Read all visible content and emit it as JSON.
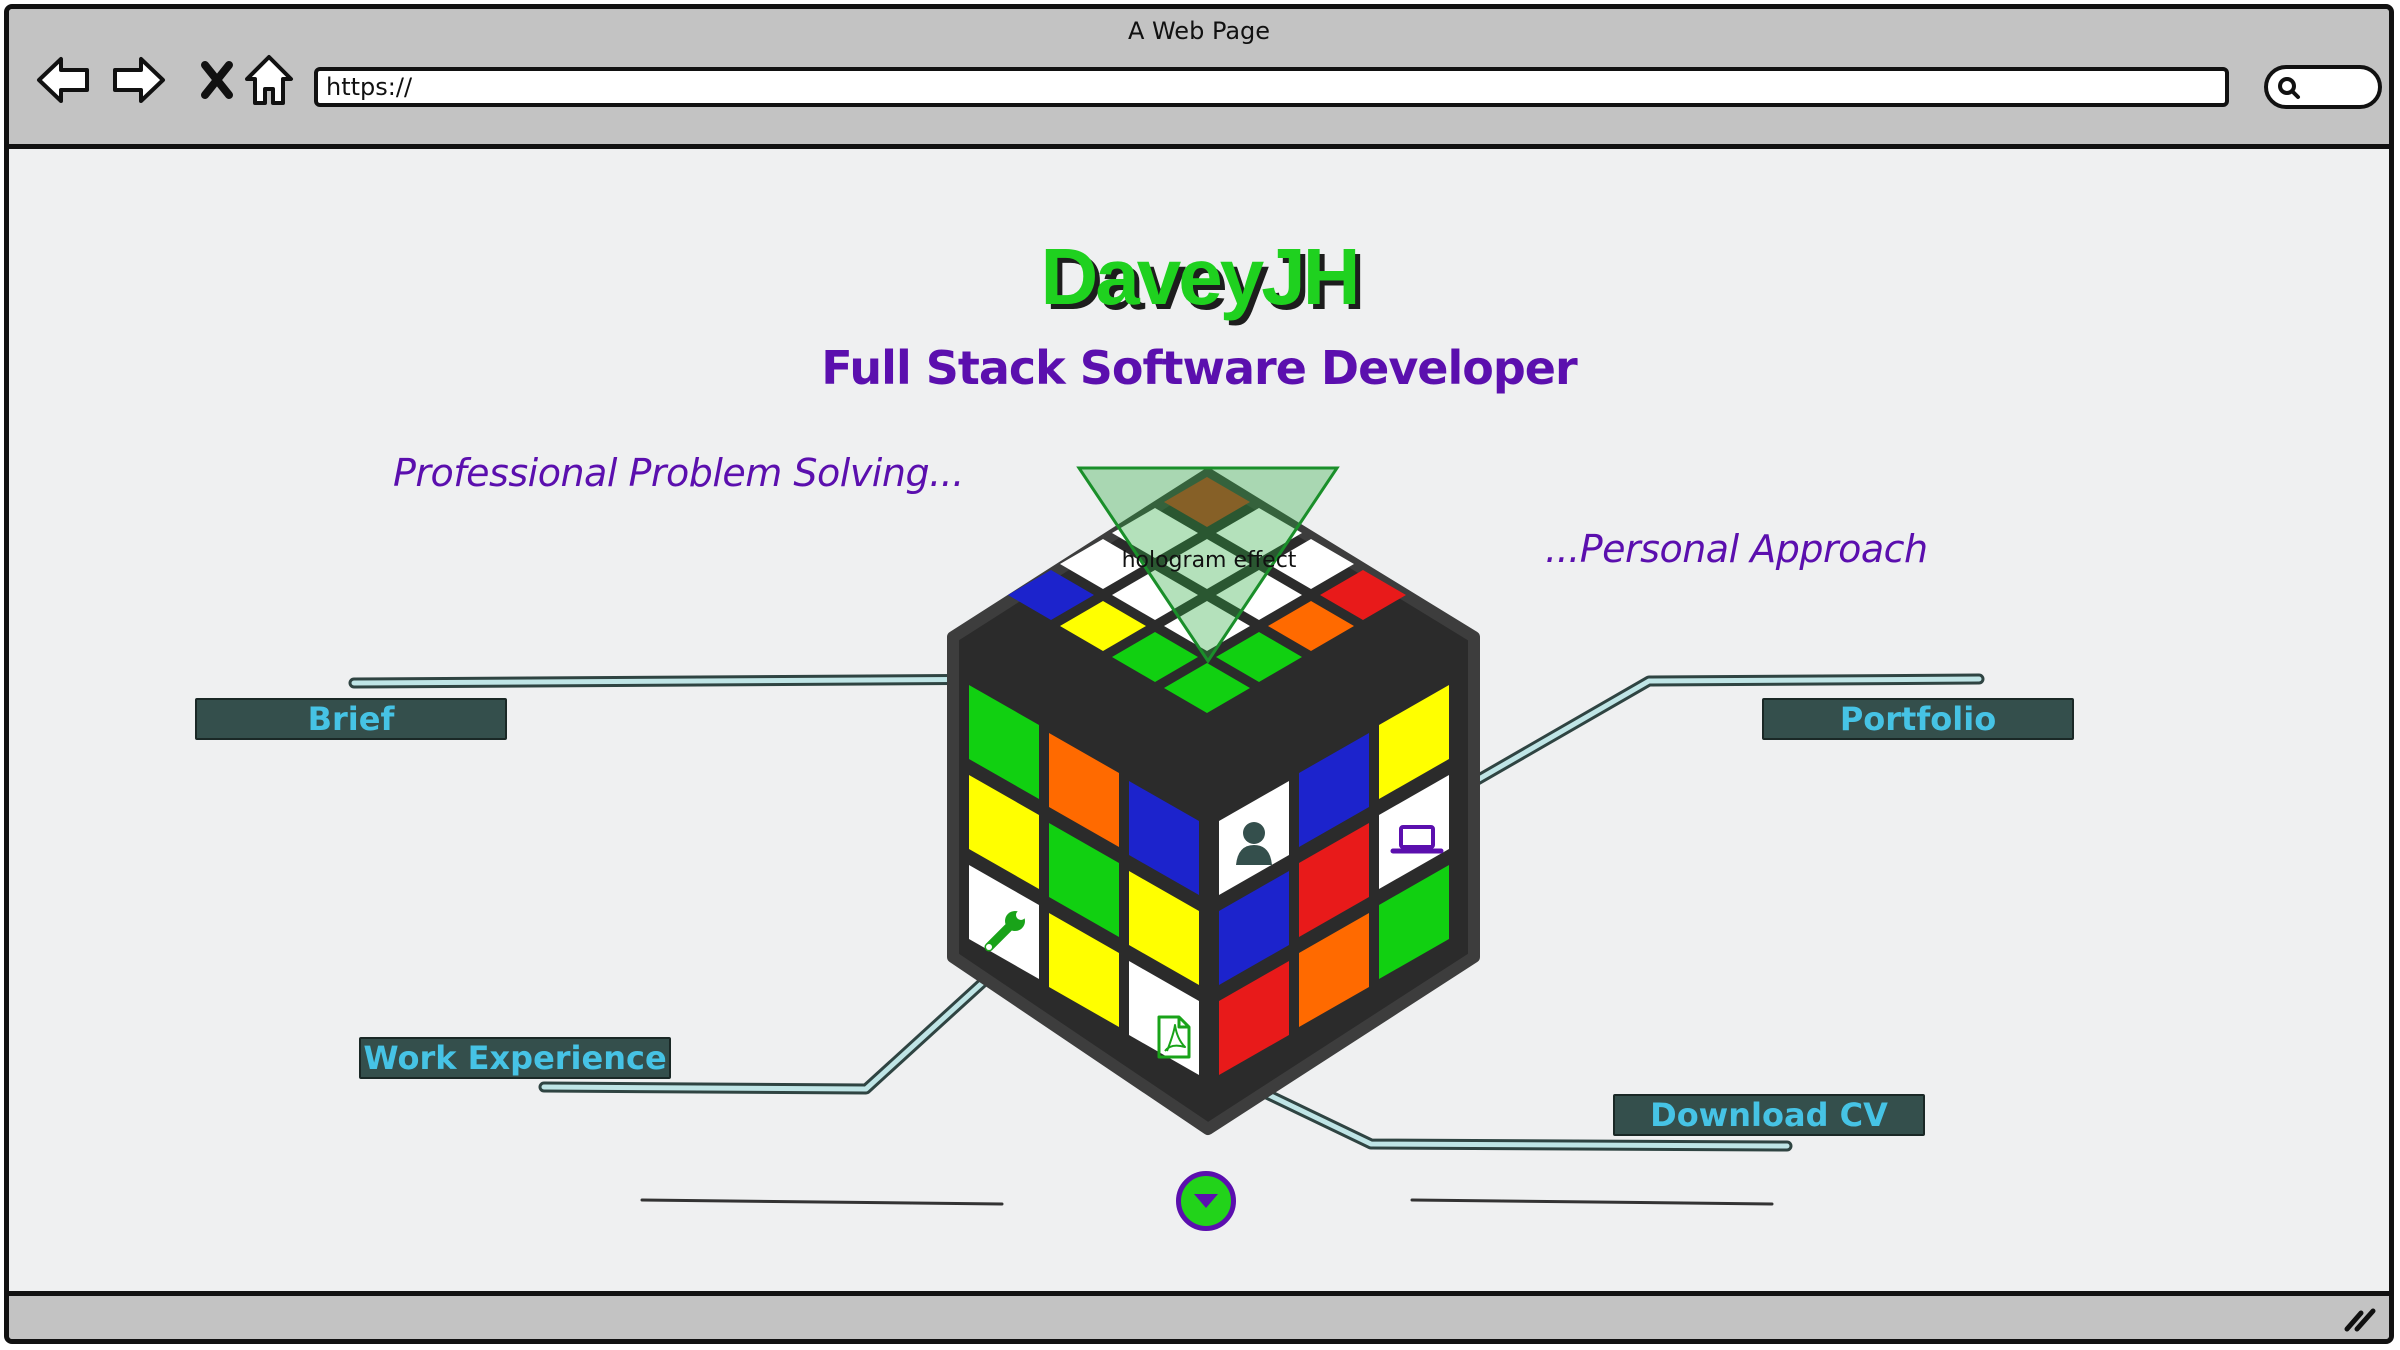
{
  "window": {
    "title": "A Web Page",
    "url": "https://"
  },
  "header": {
    "logo": "DaveyJH",
    "subtitle": "Full Stack Software Developer"
  },
  "taglines": {
    "left": "Professional Problem Solving...",
    "right": "...Personal Approach"
  },
  "hologram": {
    "label": "hologram effect"
  },
  "nav": {
    "brief": "Brief",
    "portfolio": "Portfolio",
    "work_experience": "Work Experience",
    "download_cv": "Download CV"
  },
  "cube_icons": [
    "user-icon",
    "laptop-icon",
    "wrench-icon",
    "pdf-icon"
  ],
  "colors": {
    "logo": "#1fd11f",
    "accent_purple": "#5b0fae",
    "button_bg": "#344f4c",
    "button_text": "#46c3e5",
    "cube_red": "#e81a1a",
    "cube_green": "#11d011",
    "cube_blue": "#1c23cc",
    "cube_yellow": "#ffff00",
    "cube_orange": "#ff6a00",
    "cube_white": "#ffffff"
  }
}
